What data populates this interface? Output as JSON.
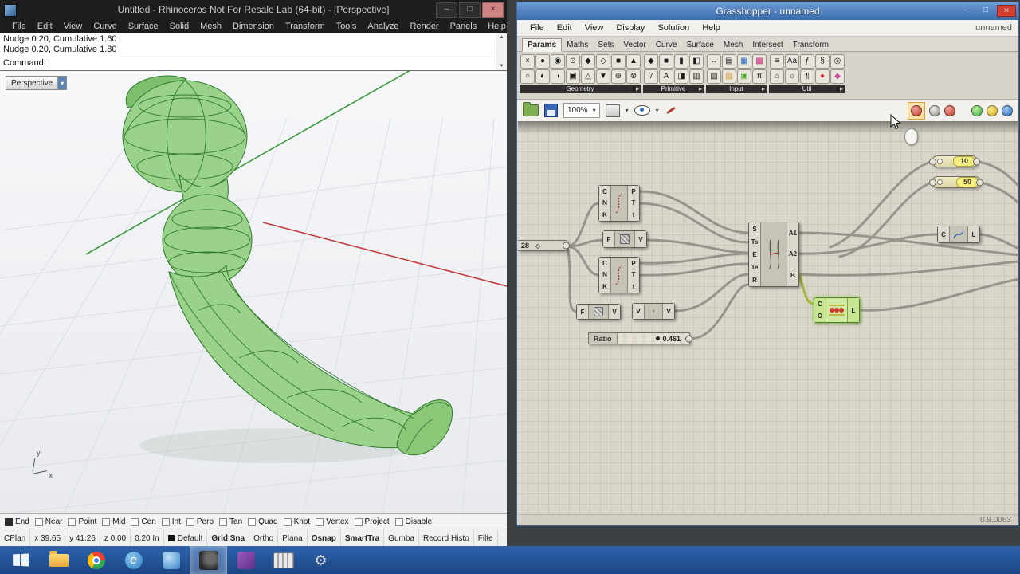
{
  "icons": {
    "dropdown": "▾",
    "minimize": "–",
    "maximize": "□",
    "close": "×",
    "up": "▲",
    "down": "▼",
    "diamond": "◇",
    "group_arrow": "▸",
    "updown": "↕",
    "ie_glyph": "e",
    "gear": "⚙"
  },
  "rhino": {
    "title": "Untitled - Rhinoceros Not For Resale Lab (64-bit) - [Perspective]",
    "menus": [
      "File",
      "Edit",
      "View",
      "Curve",
      "Surface",
      "Solid",
      "Mesh",
      "Dimension",
      "Transform",
      "Tools",
      "Analyze",
      "Render",
      "Panels",
      "Help"
    ],
    "command": {
      "history1": "Nudge 0.20, Cumulative 1.60",
      "history2": "Nudge 0.20, Cumulative 1.80",
      "prompt": "Command:"
    },
    "viewport": {
      "tab": "Perspective",
      "axis_x": "x",
      "axis_y": "y"
    },
    "osnap": [
      "End",
      "Near",
      "Point",
      "Mid",
      "Cen",
      "Int",
      "Perp",
      "Tan",
      "Quad",
      "Knot",
      "Vertex",
      "Project",
      "Disable"
    ],
    "osnap_checked": "End",
    "status": [
      "CPlan",
      "x 39.65",
      "y 41.26",
      "z 0.00",
      "0.20 In",
      "Default",
      "Grid Sna",
      "Ortho",
      "Plana",
      "Osnap",
      "SmartTra",
      "Gumba",
      "Record Histo",
      "Filte"
    ]
  },
  "grasshopper": {
    "title": "Grasshopper - unnamed",
    "menus": [
      "File",
      "Edit",
      "View",
      "Display",
      "Solution",
      "Help"
    ],
    "session": "unnamed",
    "tabs": [
      "Params",
      "Maths",
      "Sets",
      "Vector",
      "Curve",
      "Surface",
      "Mesh",
      "Intersect",
      "Transform"
    ],
    "active_tab": "Params",
    "ribbon": {
      "geometry_label": "Geometry",
      "primitive_label": "Primitive",
      "input_label": "Input",
      "util_label": "Util",
      "geometry_icons": [
        "×",
        "●",
        "◉",
        "⊙",
        "◆",
        "◇",
        "■",
        "▲",
        "○",
        "◐",
        "◑",
        "▣",
        "△",
        "▼",
        "⊕",
        "⊗"
      ],
      "primitive_icons": [
        "◆",
        "■",
        "▮",
        "◧",
        "7",
        "A",
        "◨",
        "▥"
      ],
      "input_icons": [
        "↔",
        "▤",
        "▦",
        "▩",
        "▧",
        "▨",
        "▣",
        "π"
      ],
      "util_icons": [
        "≡",
        "Aa",
        "ƒ",
        "§",
        "◎",
        "⌂",
        "☼",
        "¶",
        "●",
        "◆"
      ]
    },
    "toolbar": {
      "zoom": "100%"
    },
    "version": "0.9.0063",
    "canvas": {
      "slider10": "10",
      "slider50": "50",
      "slider28": "28",
      "ratio_label": "Ratio",
      "ratio_value": "0.461",
      "divide1": {
        "in": [
          "C",
          "N",
          "K"
        ],
        "out": [
          "P",
          "T",
          "t"
        ]
      },
      "divide2": {
        "in": [
          "C",
          "N",
          "K"
        ],
        "out": [
          "P",
          "T",
          "t"
        ]
      },
      "fv1": {
        "in": "F",
        "out": "V"
      },
      "fv2": {
        "in": "F",
        "out": "V"
      },
      "vv": {
        "in": "V",
        "out": "V"
      },
      "sweep": {
        "in": [
          "S",
          "Ts",
          "E",
          "Te",
          "R"
        ],
        "out": [
          "A1",
          "A2",
          "B"
        ]
      },
      "loft": {
        "in": [
          "C",
          "O"
        ],
        "out": "L"
      },
      "curve": {
        "in": "C",
        "out": "L"
      }
    }
  }
}
